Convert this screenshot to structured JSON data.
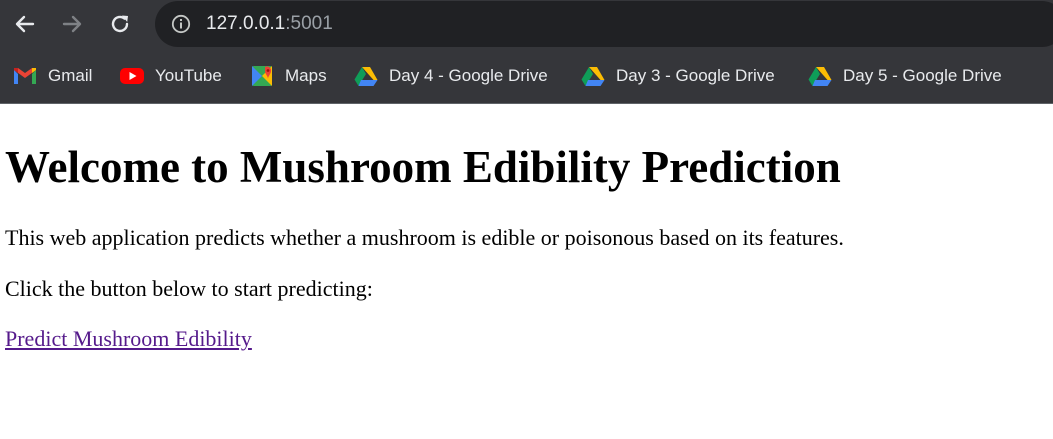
{
  "browser": {
    "url_host": "127.0.0.1",
    "url_port": ":5001",
    "bookmarks": [
      {
        "label": "Gmail",
        "icon": "gmail-icon"
      },
      {
        "label": "YouTube",
        "icon": "youtube-icon"
      },
      {
        "label": "Maps",
        "icon": "maps-icon"
      },
      {
        "label": "Day 4 - Google Drive",
        "icon": "google-drive-icon"
      },
      {
        "label": "Day 3 - Google Drive",
        "icon": "google-drive-icon"
      },
      {
        "label": "Day 5 - Google Drive",
        "icon": "google-drive-icon"
      }
    ],
    "colors": {
      "chrome": "#35363a",
      "omnibox": "#202124",
      "visited_link": "#551a8b"
    }
  },
  "page": {
    "heading": "Welcome to Mushroom Edibility Prediction",
    "description": "This web application predicts whether a mushroom is edible or poisonous based on its features.",
    "cta_text": "Click the button below to start predicting:",
    "link_label": "Predict Mushroom Edibility"
  }
}
